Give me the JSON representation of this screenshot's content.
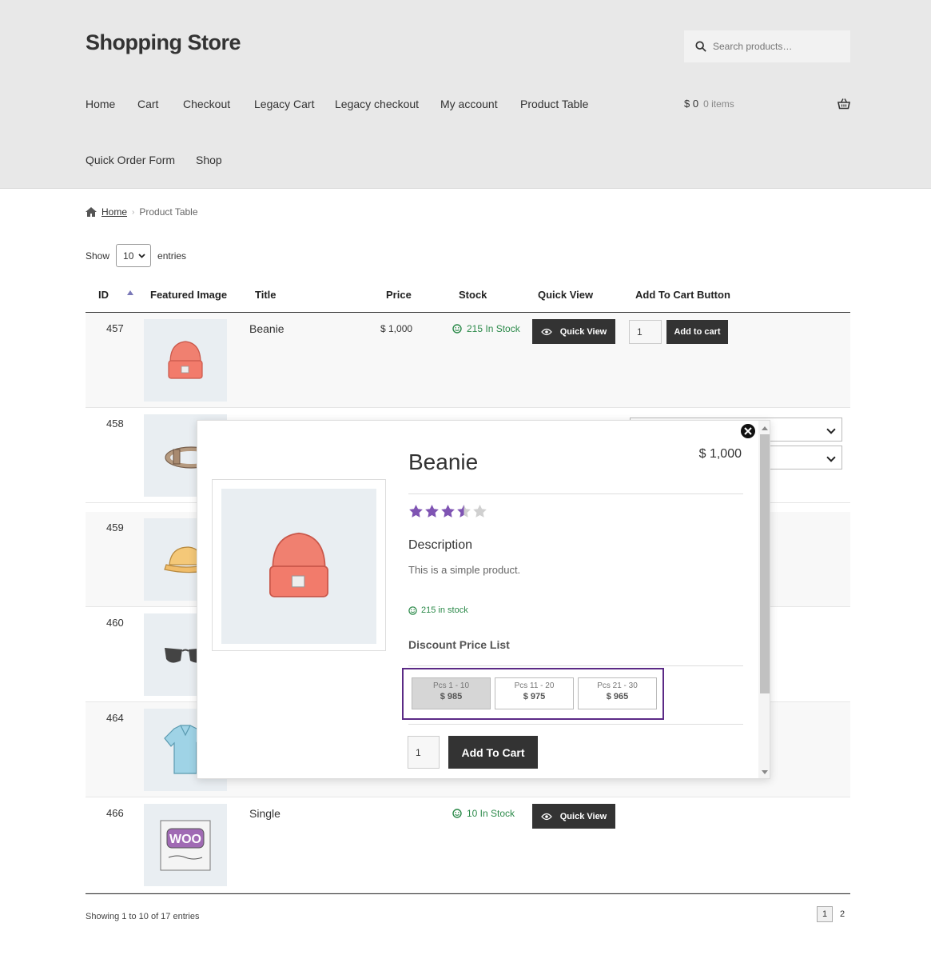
{
  "site": {
    "title": "Shopping Store"
  },
  "search": {
    "placeholder": "Search products…"
  },
  "nav": {
    "items": [
      "Home",
      "Cart",
      "Checkout",
      "Legacy Cart",
      "Legacy checkout",
      "My account",
      "Product Table",
      "Quick Order Form",
      "Shop"
    ]
  },
  "cart": {
    "amount": "$ 0",
    "count": "0 items"
  },
  "breadcrumb": {
    "home": "Home",
    "current": "Product Table"
  },
  "entries": {
    "show": "Show",
    "value": "10",
    "suffix": "entries"
  },
  "table": {
    "headers": [
      "ID",
      "Featured Image",
      "Title",
      "Price",
      "Stock",
      "Quick View",
      "Add To Cart Button"
    ],
    "rows": [
      {
        "id": "457",
        "title": "Beanie",
        "price": "$ 1,000",
        "stock": "215 In Stock",
        "quick_view": "Quick View",
        "qty": "1",
        "add_to_cart": "Add to cart"
      },
      {
        "id": "458"
      },
      {
        "id": "459"
      },
      {
        "id": "460"
      },
      {
        "id": "464"
      },
      {
        "id": "466",
        "title": "Single",
        "stock": "10 In Stock",
        "quick_view": "Quick View"
      }
    ]
  },
  "footer": {
    "showing": "Showing 1 to 10 of 17 entries",
    "pages": [
      "1",
      "2"
    ]
  },
  "modal": {
    "title": "Beanie",
    "price": "$ 1,000",
    "rating": 3.5,
    "description_heading": "Description",
    "description": "This is a simple product.",
    "stock": "215 in stock",
    "discount_heading": "Discount Price List",
    "tiers": [
      {
        "range": "Pcs 1 - 10",
        "price": "$ 985"
      },
      {
        "range": "Pcs 11 - 20",
        "price": "$ 975"
      },
      {
        "range": "Pcs 21 - 30",
        "price": "$ 965"
      }
    ],
    "qty": "1",
    "add_to_cart": "Add To Cart"
  },
  "colors": {
    "accent": "#5b2a86",
    "star": "#7f54b3",
    "stock": "#2c8a4a",
    "button": "#333333"
  }
}
